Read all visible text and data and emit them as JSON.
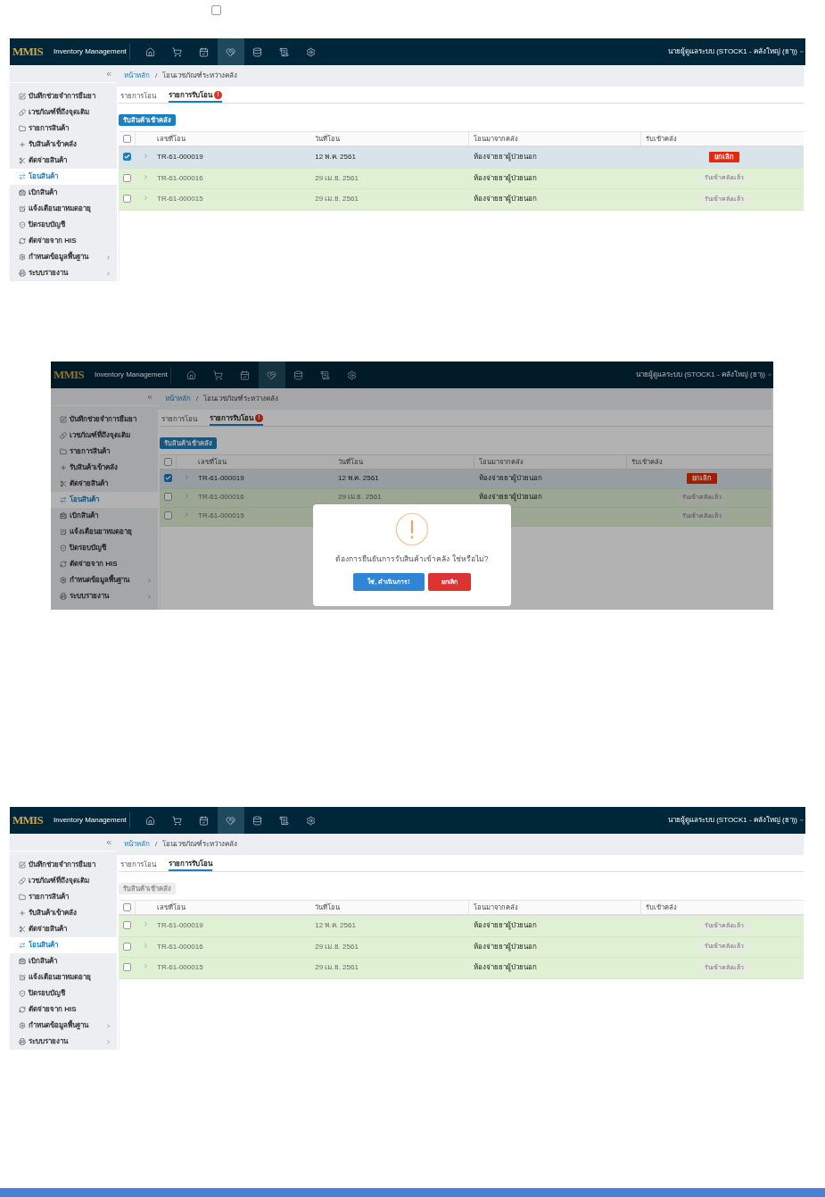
{
  "top_checkbox": {
    "checked": false
  },
  "breadcrumb_separator": "/",
  "screens": [
    {
      "brand": {
        "logo": "MMIS",
        "title": "Inventory Management"
      },
      "nav": [
        {
          "kind": "home",
          "selected": false
        },
        {
          "kind": "cart",
          "selected": false
        },
        {
          "kind": "calendar",
          "selected": false
        },
        {
          "kind": "transfer",
          "selected": true
        },
        {
          "kind": "database",
          "selected": false
        },
        {
          "kind": "scroll",
          "selected": false
        },
        {
          "kind": "settings",
          "selected": false
        }
      ],
      "user": "นายผู้ดูแลระบบ (STOCK1 - คลังใหญ่ (ยา))",
      "menu": [
        {
          "label": "บันทึกช่วยจำการยืมยา",
          "selected": false,
          "submenu": false
        },
        {
          "label": "เวชภัณฑ์ที่ถึงจุดเติม",
          "selected": false,
          "submenu": false
        },
        {
          "label": "รายการสินค้า",
          "selected": false,
          "submenu": false
        },
        {
          "label": "รับสินค้าเข้าคลัง",
          "selected": false,
          "submenu": false
        },
        {
          "label": "ตัดจ่ายสินค้า",
          "selected": false,
          "submenu": false
        },
        {
          "label": "โอนสินค้า",
          "selected": true,
          "submenu": false
        },
        {
          "label": "เบิกสินค้า",
          "selected": false,
          "submenu": false
        },
        {
          "label": "แจ้งเตือนยาหมดอายุ",
          "selected": false,
          "submenu": false
        },
        {
          "label": "ปิดรอบบัญชี",
          "selected": false,
          "submenu": false
        },
        {
          "label": "ตัดจ่ายจาก HIS",
          "selected": false,
          "submenu": false
        },
        {
          "label": "กำหนดข้อมูลพื้นฐาน",
          "selected": false,
          "submenu": true
        },
        {
          "label": "ระบบรายงาน",
          "selected": false,
          "submenu": true
        }
      ],
      "breadcrumb": [
        "หน้าหลัก",
        "โอนเวชภัณฑ์ระหว่างคลัง"
      ],
      "tabs": [
        {
          "label": "รายการโอน",
          "selected": false
        },
        {
          "label": "รายการรับโอน",
          "selected": true,
          "badge": "!"
        }
      ],
      "receive_button": {
        "label": "รับสินค้าเข้าคลัง",
        "disabled": false
      },
      "table": {
        "select_all": {
          "checked": false
        },
        "columns": [
          "เลขที่โอน",
          "วันที่โอน",
          "โอนมาจากคลัง",
          "รับเข้าคลัง"
        ],
        "rows": [
          {
            "checked": true,
            "number": "TR-61-000019",
            "date": "12 พ.ค. 2561",
            "from": "ห้องจ่ายยาผู้ป่วยนอก",
            "action": {
              "kind": "cancel",
              "label": "ยกเลิก"
            }
          },
          {
            "checked": false,
            "number": "TR-61-000016",
            "date": "29 เม.ย. 2561",
            "from": "ห้องจ่ายยาผู้ป่วยนอก",
            "action": {
              "kind": "done",
              "label": "รับเข้าคลังแล้ว"
            }
          },
          {
            "checked": false,
            "number": "TR-61-000015",
            "date": "29 เม.ย. 2561",
            "from": "ห้องจ่ายยาผู้ป่วยนอก",
            "action": {
              "kind": "done",
              "label": "รับเข้าคลังแล้ว"
            }
          }
        ]
      }
    },
    {
      "brand": {
        "logo": "MMIS",
        "title": "Inventory Management"
      },
      "nav": [
        {
          "kind": "home",
          "selected": false
        },
        {
          "kind": "cart",
          "selected": false
        },
        {
          "kind": "calendar",
          "selected": false
        },
        {
          "kind": "transfer",
          "selected": true
        },
        {
          "kind": "database",
          "selected": false
        },
        {
          "kind": "scroll",
          "selected": false
        },
        {
          "kind": "settings",
          "selected": false
        }
      ],
      "user": "นายผู้ดูแลระบบ (STOCK1 - คลังใหญ่ (ยา))",
      "menu": [
        {
          "label": "บันทึกช่วยจำการยืมยา",
          "selected": false,
          "submenu": false
        },
        {
          "label": "เวชภัณฑ์ที่ถึงจุดเติม",
          "selected": false,
          "submenu": false
        },
        {
          "label": "รายการสินค้า",
          "selected": false,
          "submenu": false
        },
        {
          "label": "รับสินค้าเข้าคลัง",
          "selected": false,
          "submenu": false
        },
        {
          "label": "ตัดจ่ายสินค้า",
          "selected": false,
          "submenu": false
        },
        {
          "label": "โอนสินค้า",
          "selected": true,
          "submenu": false
        },
        {
          "label": "เบิกสินค้า",
          "selected": false,
          "submenu": false
        },
        {
          "label": "แจ้งเตือนยาหมดอายุ",
          "selected": false,
          "submenu": false
        },
        {
          "label": "ปิดรอบบัญชี",
          "selected": false,
          "submenu": false
        },
        {
          "label": "ตัดจ่ายจาก HIS",
          "selected": false,
          "submenu": false
        },
        {
          "label": "กำหนดข้อมูลพื้นฐาน",
          "selected": false,
          "submenu": true
        },
        {
          "label": "ระบบรายงาน",
          "selected": false,
          "submenu": true
        }
      ],
      "breadcrumb": [
        "หน้าหลัก",
        "โอนเวชภัณฑ์ระหว่างคลัง"
      ],
      "tabs": [
        {
          "label": "รายการโอน",
          "selected": false
        },
        {
          "label": "รายการรับโอน",
          "selected": true,
          "badge": "!"
        }
      ],
      "receive_button": {
        "label": "รับสินค้าเข้าคลัง",
        "disabled": false
      },
      "table": {
        "select_all": {
          "checked": false
        },
        "columns": [
          "เลขที่โอน",
          "วันที่โอน",
          "โอนมาจากคลัง",
          "รับเข้าคลัง"
        ],
        "rows": [
          {
            "checked": true,
            "number": "TR-61-000019",
            "date": "12 พ.ค. 2561",
            "from": "ห้องจ่ายยาผู้ป่วยนอก",
            "action": {
              "kind": "cancel",
              "label": "ยกเลิก"
            }
          },
          {
            "checked": false,
            "number": "TR-61-000016",
            "date": "29 เม.ย. 2561",
            "from": "ห้องจ่ายยาผู้ป่วยนอก",
            "action": {
              "kind": "done",
              "label": "รับเข้าคลังแล้ว"
            }
          },
          {
            "checked": false,
            "number": "TR-61-000015",
            "action": {
              "kind": "done",
              "label": "รับเข้าคลังแล้ว"
            }
          }
        ]
      },
      "dialog": {
        "message": "ต้องการยืนยันการรับสินค้าเข้าคลัง ใช่หรือไม่?",
        "confirm": "ใช่, ดำเนินการ!",
        "cancel": "ยกเลิก"
      }
    },
    {
      "brand": {
        "logo": "MMIS",
        "title": "Inventory Management"
      },
      "nav": [
        {
          "kind": "home",
          "selected": false
        },
        {
          "kind": "cart",
          "selected": false
        },
        {
          "kind": "calendar",
          "selected": false
        },
        {
          "kind": "transfer",
          "selected": true
        },
        {
          "kind": "database",
          "selected": false
        },
        {
          "kind": "scroll",
          "selected": false
        },
        {
          "kind": "settings",
          "selected": false
        }
      ],
      "user": "นายผู้ดูแลระบบ (STOCK1 - คลังใหญ่ (ยา))",
      "menu": [
        {
          "label": "บันทึกช่วยจำการยืมยา",
          "selected": false,
          "submenu": false
        },
        {
          "label": "เวชภัณฑ์ที่ถึงจุดเติม",
          "selected": false,
          "submenu": false
        },
        {
          "label": "รายการสินค้า",
          "selected": false,
          "submenu": false
        },
        {
          "label": "รับสินค้าเข้าคลัง",
          "selected": false,
          "submenu": false
        },
        {
          "label": "ตัดจ่ายสินค้า",
          "selected": false,
          "submenu": false
        },
        {
          "label": "โอนสินค้า",
          "selected": true,
          "submenu": false
        },
        {
          "label": "เบิกสินค้า",
          "selected": false,
          "submenu": false
        },
        {
          "label": "แจ้งเตือนยาหมดอายุ",
          "selected": false,
          "submenu": false
        },
        {
          "label": "ปิดรอบบัญชี",
          "selected": false,
          "submenu": false
        },
        {
          "label": "ตัดจ่ายจาก HIS",
          "selected": false,
          "submenu": false
        },
        {
          "label": "กำหนดข้อมูลพื้นฐาน",
          "selected": false,
          "submenu": true
        },
        {
          "label": "ระบบรายงาน",
          "selected": false,
          "submenu": true
        }
      ],
      "breadcrumb": [
        "หน้าหลัก",
        "โอนเวชภัณฑ์ระหว่างคลัง"
      ],
      "tabs": [
        {
          "label": "รายการโอน",
          "selected": false
        },
        {
          "label": "รายการรับโอน",
          "selected": true
        }
      ],
      "receive_button": {
        "label": "รับสินค้าเข้าคลัง",
        "disabled": true
      },
      "table": {
        "select_all": {
          "checked": false
        },
        "columns": [
          "เลขที่โอน",
          "วันที่โอน",
          "โอนมาจากคลัง",
          "รับเข้าคลัง"
        ],
        "rows": [
          {
            "checked": false,
            "number": "TR-61-000019",
            "date": "12 พ.ค. 2561",
            "from": "ห้องจ่ายยาผู้ป่วยนอก",
            "action": {
              "kind": "done",
              "label": "รับเข้าคลังแล้ว"
            }
          },
          {
            "checked": false,
            "number": "TR-61-000016",
            "date": "29 เม.ย. 2561",
            "from": "ห้องจ่ายยาผู้ป่วยนอก",
            "action": {
              "kind": "done",
              "label": "รับเข้าคลังแล้ว"
            }
          },
          {
            "checked": false,
            "number": "TR-61-000015",
            "date": "29 เม.ย. 2561",
            "from": "ห้องจ่ายยาผู้ป่วยนอก",
            "action": {
              "kind": "done",
              "label": "รับเข้าคลังแล้ว"
            }
          }
        ]
      }
    }
  ]
}
